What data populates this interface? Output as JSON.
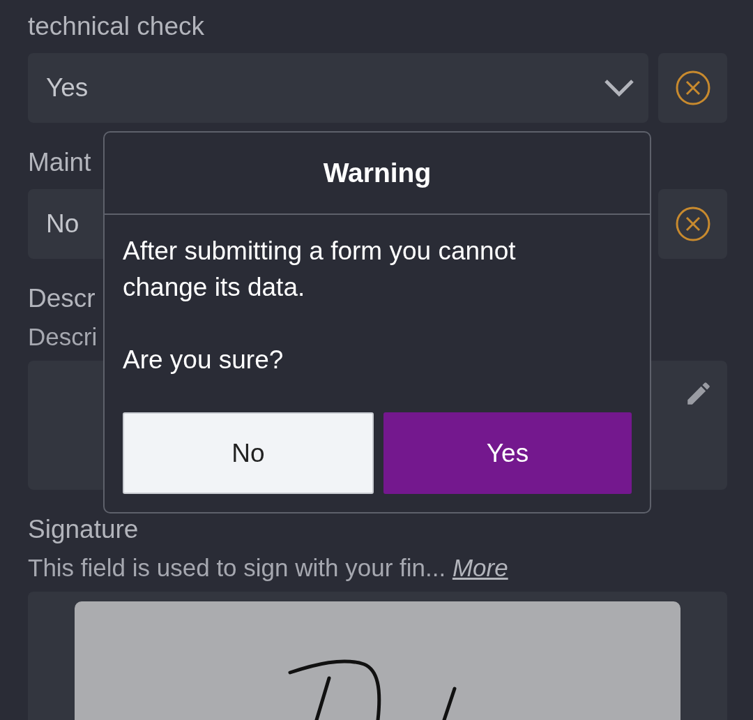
{
  "fields": [
    {
      "kind": "select",
      "label": "technical check",
      "value": "Yes",
      "chevron": true
    },
    {
      "kind": "select",
      "label": "Maint",
      "value": "No"
    },
    {
      "kind": "textarea",
      "label": "Descr",
      "hint": "Descri"
    },
    {
      "kind": "signature",
      "label": "Signature",
      "hint": "This field is used to sign with your fin...",
      "link": "More"
    }
  ],
  "dialog": {
    "title": "Warning",
    "message": [
      "After submitting a form you cannot change its data.",
      "Are you sure?"
    ],
    "buttons": [
      {
        "label": "No",
        "kind": "secondary"
      },
      {
        "label": "Yes",
        "kind": "primary"
      }
    ]
  }
}
